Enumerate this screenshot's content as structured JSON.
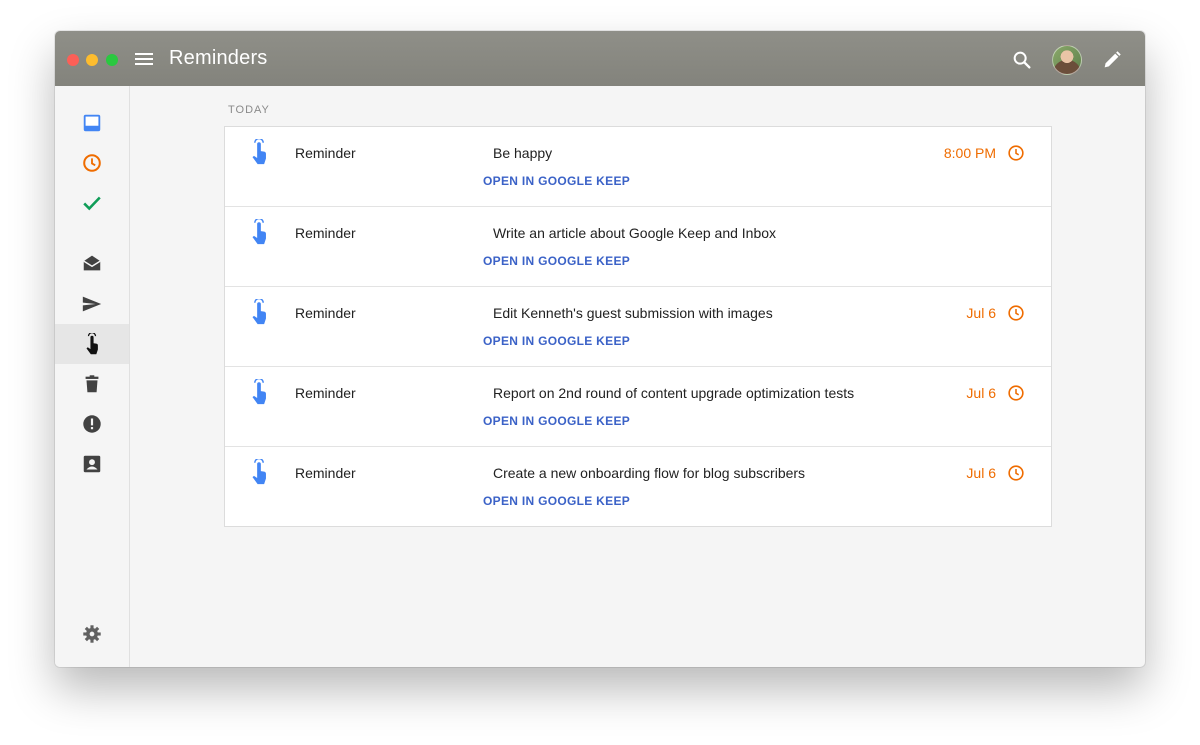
{
  "window": {
    "title": "Reminders"
  },
  "section": {
    "label": "TODAY"
  },
  "reminders": [
    {
      "type": "Reminder",
      "title": "Be happy",
      "link": "OPEN IN GOOGLE KEEP",
      "time": "8:00 PM",
      "has_clock": true
    },
    {
      "type": "Reminder",
      "title": "Write an article about Google Keep and Inbox",
      "link": "OPEN IN GOOGLE KEEP",
      "time": "",
      "has_clock": false
    },
    {
      "type": "Reminder",
      "title": "Edit Kenneth's guest submission with images",
      "link": "OPEN IN GOOGLE KEEP",
      "time": "Jul 6",
      "has_clock": true
    },
    {
      "type": "Reminder",
      "title": "Report on 2nd round of content upgrade optimization tests",
      "link": "OPEN IN GOOGLE KEEP",
      "time": "Jul 6",
      "has_clock": true
    },
    {
      "type": "Reminder",
      "title": "Create a new onboarding flow for blog subscribers",
      "link": "OPEN IN GOOGLE KEEP",
      "time": "Jul 6",
      "has_clock": true
    }
  ],
  "sidebar_icons": [
    "inbox-icon",
    "snoozed-icon",
    "done-icon",
    "drafts-icon",
    "sent-icon",
    "reminders-icon",
    "trash-icon",
    "spam-icon",
    "contacts-icon",
    "settings-icon"
  ],
  "colors": {
    "accent_blue": "#3b62c7",
    "time_orange": "#ef6c00",
    "done_green": "#0f9d58",
    "titlebar": "#8a8a83"
  }
}
